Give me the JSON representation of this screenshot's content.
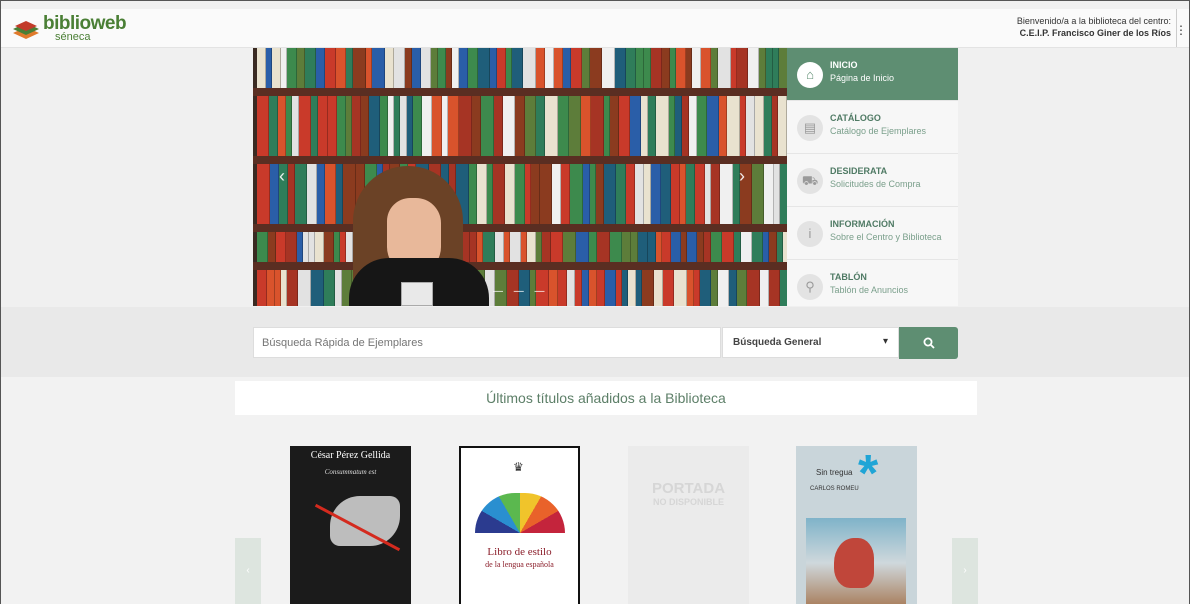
{
  "header": {
    "logo_name": "biblioweb",
    "logo_sub": "séneca",
    "welcome": "Bienvenido/a a la biblioteca del centro:",
    "center": "C.E.I.P. Francisco Giner de los Ríos"
  },
  "menu": [
    {
      "title": "INICIO",
      "subtitle": "Página de Inicio",
      "icon": "home-icon",
      "active": true
    },
    {
      "title": "CATÁLOGO",
      "subtitle": "Catálogo de Ejemplares",
      "icon": "book-icon",
      "active": false
    },
    {
      "title": "DESIDERATA",
      "subtitle": "Solicitudes de Compra",
      "icon": "cart-icon",
      "active": false
    },
    {
      "title": "INFORMACIÓN",
      "subtitle": "Sobre el Centro y Biblioteca",
      "icon": "info-icon",
      "active": false
    },
    {
      "title": "TABLÓN",
      "subtitle": "Tablón de Anuncios",
      "icon": "pin-icon",
      "active": false
    }
  ],
  "search": {
    "placeholder": "Búsqueda Rápida de Ejemplares",
    "scope": "Búsqueda General"
  },
  "latest": {
    "title": "Últimos títulos añadidos a la Biblioteca",
    "books": [
      {
        "author": "César Pérez Gellida",
        "title": "Consummatum est"
      },
      {
        "title": "Libro de estilo",
        "subtitle": "de la lengua española"
      },
      {
        "placeholder_line1": "PORTADA",
        "placeholder_line2": "NO DISPONIBLE"
      },
      {
        "title": "Sin tregua",
        "author": "CARLOS ROMEU"
      }
    ]
  },
  "colors": {
    "accent": "#5e8e72",
    "accent_text": "#4f7a64",
    "title_text": "#5d7f68"
  }
}
